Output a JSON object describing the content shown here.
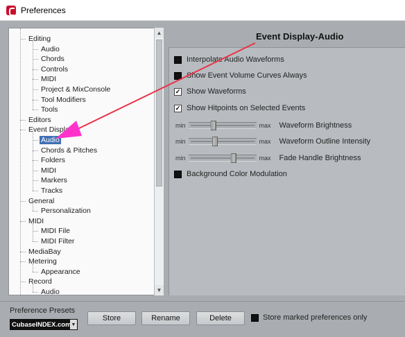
{
  "window": {
    "title": "Preferences"
  },
  "tree": {
    "items": [
      {
        "label": "Editing",
        "level": 0
      },
      {
        "label": "Audio",
        "level": 1
      },
      {
        "label": "Chords",
        "level": 1
      },
      {
        "label": "Controls",
        "level": 1
      },
      {
        "label": "MIDI",
        "level": 1
      },
      {
        "label": "Project & MixConsole",
        "level": 1
      },
      {
        "label": "Tool Modifiers",
        "level": 1
      },
      {
        "label": "Tools",
        "level": 1
      },
      {
        "label": "Editors",
        "level": 0
      },
      {
        "label": "Event Display",
        "level": 0
      },
      {
        "label": "Audio",
        "level": 1,
        "selected": true
      },
      {
        "label": "Chords & Pitches",
        "level": 1
      },
      {
        "label": "Folders",
        "level": 1
      },
      {
        "label": "MIDI",
        "level": 1
      },
      {
        "label": "Markers",
        "level": 1
      },
      {
        "label": "Tracks",
        "level": 1
      },
      {
        "label": "General",
        "level": 0
      },
      {
        "label": "Personalization",
        "level": 1
      },
      {
        "label": "MIDI",
        "level": 0
      },
      {
        "label": "MIDI File",
        "level": 1
      },
      {
        "label": "MIDI Filter",
        "level": 1
      },
      {
        "label": "MediaBay",
        "level": 0
      },
      {
        "label": "Metering",
        "level": 0
      },
      {
        "label": "Appearance",
        "level": 1
      },
      {
        "label": "Record",
        "level": 0
      },
      {
        "label": "Audio",
        "level": 1
      }
    ]
  },
  "panel": {
    "header": "Event Display-Audio",
    "options": [
      {
        "label": "Interpolate Audio Waveforms",
        "checked": false
      },
      {
        "label": "Show Event Volume Curves Always",
        "checked": false
      },
      {
        "label": "Show Waveforms",
        "checked": true
      },
      {
        "label": "Show Hitpoints on Selected Events",
        "checked": true
      }
    ],
    "sliders": [
      {
        "min_label": "min",
        "max_label": "max",
        "label": "Waveform Brightness",
        "value": 0.36
      },
      {
        "min_label": "min",
        "max_label": "max",
        "label": "Waveform Outline Intensity",
        "value": 0.38
      },
      {
        "min_label": "min",
        "max_label": "max",
        "label": "Fade Handle Brightness",
        "value": 0.68
      }
    ],
    "background_option": {
      "label": "Background Color Modulation",
      "checked": false
    }
  },
  "bottom": {
    "presets_label": "Preference Presets",
    "preset_value": "CubaseINDEX.com",
    "store_label": "Store",
    "rename_label": "Rename",
    "delete_label": "Delete",
    "store_marked_label": "Store marked preferences only",
    "store_marked_checked": false
  },
  "colors": {
    "selection": "#3f6fb5",
    "annotation_arrow": "#e8344a",
    "annotation_pointer": "#ff33cc"
  }
}
